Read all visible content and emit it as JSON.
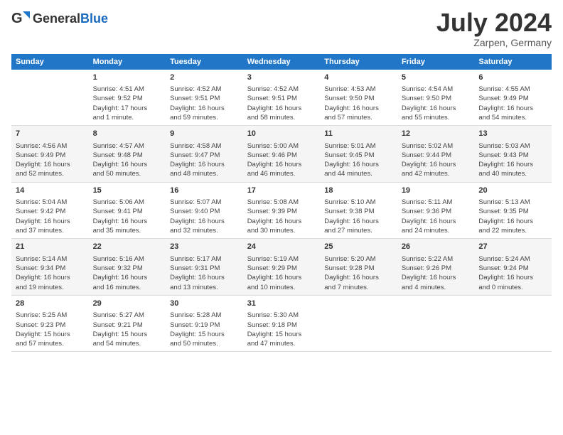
{
  "header": {
    "logo_general": "General",
    "logo_blue": "Blue",
    "month": "July 2024",
    "location": "Zarpen, Germany"
  },
  "columns": [
    "Sunday",
    "Monday",
    "Tuesday",
    "Wednesday",
    "Thursday",
    "Friday",
    "Saturday"
  ],
  "weeks": [
    [
      {
        "day": "",
        "info": ""
      },
      {
        "day": "1",
        "info": "Sunrise: 4:51 AM\nSunset: 9:52 PM\nDaylight: 17 hours\nand 1 minute."
      },
      {
        "day": "2",
        "info": "Sunrise: 4:52 AM\nSunset: 9:51 PM\nDaylight: 16 hours\nand 59 minutes."
      },
      {
        "day": "3",
        "info": "Sunrise: 4:52 AM\nSunset: 9:51 PM\nDaylight: 16 hours\nand 58 minutes."
      },
      {
        "day": "4",
        "info": "Sunrise: 4:53 AM\nSunset: 9:50 PM\nDaylight: 16 hours\nand 57 minutes."
      },
      {
        "day": "5",
        "info": "Sunrise: 4:54 AM\nSunset: 9:50 PM\nDaylight: 16 hours\nand 55 minutes."
      },
      {
        "day": "6",
        "info": "Sunrise: 4:55 AM\nSunset: 9:49 PM\nDaylight: 16 hours\nand 54 minutes."
      }
    ],
    [
      {
        "day": "7",
        "info": "Sunrise: 4:56 AM\nSunset: 9:49 PM\nDaylight: 16 hours\nand 52 minutes."
      },
      {
        "day": "8",
        "info": "Sunrise: 4:57 AM\nSunset: 9:48 PM\nDaylight: 16 hours\nand 50 minutes."
      },
      {
        "day": "9",
        "info": "Sunrise: 4:58 AM\nSunset: 9:47 PM\nDaylight: 16 hours\nand 48 minutes."
      },
      {
        "day": "10",
        "info": "Sunrise: 5:00 AM\nSunset: 9:46 PM\nDaylight: 16 hours\nand 46 minutes."
      },
      {
        "day": "11",
        "info": "Sunrise: 5:01 AM\nSunset: 9:45 PM\nDaylight: 16 hours\nand 44 minutes."
      },
      {
        "day": "12",
        "info": "Sunrise: 5:02 AM\nSunset: 9:44 PM\nDaylight: 16 hours\nand 42 minutes."
      },
      {
        "day": "13",
        "info": "Sunrise: 5:03 AM\nSunset: 9:43 PM\nDaylight: 16 hours\nand 40 minutes."
      }
    ],
    [
      {
        "day": "14",
        "info": "Sunrise: 5:04 AM\nSunset: 9:42 PM\nDaylight: 16 hours\nand 37 minutes."
      },
      {
        "day": "15",
        "info": "Sunrise: 5:06 AM\nSunset: 9:41 PM\nDaylight: 16 hours\nand 35 minutes."
      },
      {
        "day": "16",
        "info": "Sunrise: 5:07 AM\nSunset: 9:40 PM\nDaylight: 16 hours\nand 32 minutes."
      },
      {
        "day": "17",
        "info": "Sunrise: 5:08 AM\nSunset: 9:39 PM\nDaylight: 16 hours\nand 30 minutes."
      },
      {
        "day": "18",
        "info": "Sunrise: 5:10 AM\nSunset: 9:38 PM\nDaylight: 16 hours\nand 27 minutes."
      },
      {
        "day": "19",
        "info": "Sunrise: 5:11 AM\nSunset: 9:36 PM\nDaylight: 16 hours\nand 24 minutes."
      },
      {
        "day": "20",
        "info": "Sunrise: 5:13 AM\nSunset: 9:35 PM\nDaylight: 16 hours\nand 22 minutes."
      }
    ],
    [
      {
        "day": "21",
        "info": "Sunrise: 5:14 AM\nSunset: 9:34 PM\nDaylight: 16 hours\nand 19 minutes."
      },
      {
        "day": "22",
        "info": "Sunrise: 5:16 AM\nSunset: 9:32 PM\nDaylight: 16 hours\nand 16 minutes."
      },
      {
        "day": "23",
        "info": "Sunrise: 5:17 AM\nSunset: 9:31 PM\nDaylight: 16 hours\nand 13 minutes."
      },
      {
        "day": "24",
        "info": "Sunrise: 5:19 AM\nSunset: 9:29 PM\nDaylight: 16 hours\nand 10 minutes."
      },
      {
        "day": "25",
        "info": "Sunrise: 5:20 AM\nSunset: 9:28 PM\nDaylight: 16 hours\nand 7 minutes."
      },
      {
        "day": "26",
        "info": "Sunrise: 5:22 AM\nSunset: 9:26 PM\nDaylight: 16 hours\nand 4 minutes."
      },
      {
        "day": "27",
        "info": "Sunrise: 5:24 AM\nSunset: 9:24 PM\nDaylight: 16 hours\nand 0 minutes."
      }
    ],
    [
      {
        "day": "28",
        "info": "Sunrise: 5:25 AM\nSunset: 9:23 PM\nDaylight: 15 hours\nand 57 minutes."
      },
      {
        "day": "29",
        "info": "Sunrise: 5:27 AM\nSunset: 9:21 PM\nDaylight: 15 hours\nand 54 minutes."
      },
      {
        "day": "30",
        "info": "Sunrise: 5:28 AM\nSunset: 9:19 PM\nDaylight: 15 hours\nand 50 minutes."
      },
      {
        "day": "31",
        "info": "Sunrise: 5:30 AM\nSunset: 9:18 PM\nDaylight: 15 hours\nand 47 minutes."
      },
      {
        "day": "",
        "info": ""
      },
      {
        "day": "",
        "info": ""
      },
      {
        "day": "",
        "info": ""
      }
    ]
  ]
}
